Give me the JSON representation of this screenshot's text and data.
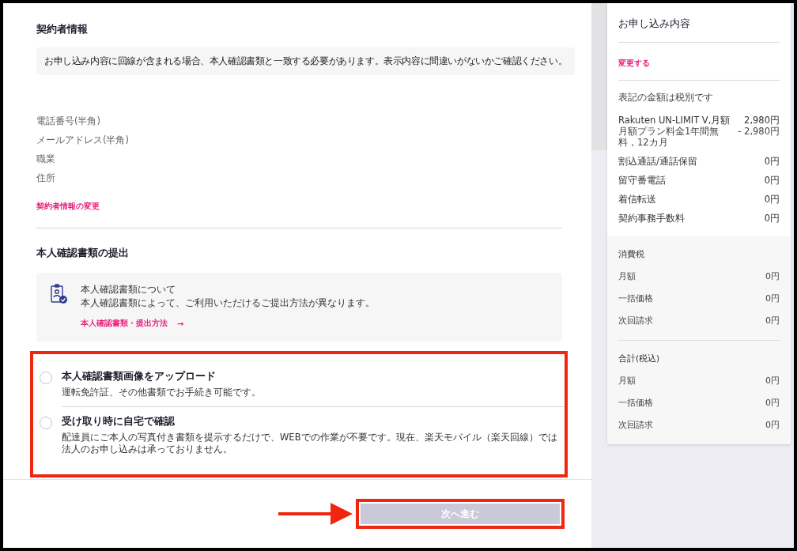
{
  "contract": {
    "title": "契約者情報",
    "notice": "お申し込み内容に回線が含まれる場合、本人確認書類と一致する必要があります。表示内容に間違いがないかご確認ください。",
    "fields": [
      "電話番号(半角)",
      "メールアドレス(半角)",
      "職業",
      "住所"
    ],
    "change_link": "契約者情報の変更"
  },
  "identity": {
    "title": "本人確認書類の提出",
    "info": {
      "title": "本人確認書類について",
      "text": "本人確認書類によって、ご利用いただけるご提出方法が異なります。",
      "link": "本人確認書類・提出方法",
      "link_arrow": "→"
    },
    "options": [
      {
        "title": "本人確認書類画像をアップロード",
        "description": "運転免許証、その他書類でお手続き可能です。",
        "selected": false
      },
      {
        "title": "受け取り時に自宅で確認",
        "description": "配達員にご本人の写真付き書類を提示するだけで、WEBでの作業が不要です。現在、楽天モバイル（楽天回線）では法人のお申し込みは承っておりません。",
        "selected": false
      }
    ]
  },
  "next_button": {
    "label": "次へ進む",
    "disabled": true
  },
  "summary": {
    "title": "お申し込み内容",
    "change_link": "変更する",
    "note": "表記の金額は税別です",
    "items": [
      {
        "label": "Rakuten UN-LIMIT V,月額",
        "price": "2,980円",
        "kind": "main"
      },
      {
        "label": "月額プラン料金1年間無料，12カ月",
        "price": "- 2,980円",
        "kind": "sub"
      },
      {
        "label": "割込通話/通話保留",
        "price": "0円",
        "kind": "main"
      },
      {
        "label": "留守番電話",
        "price": "0円",
        "kind": "main"
      },
      {
        "label": "着信転送",
        "price": "0円",
        "kind": "main"
      },
      {
        "label": "契約事務手数料",
        "price": "0円",
        "kind": "main"
      }
    ],
    "groups": [
      {
        "title": "消費税",
        "rows": [
          {
            "label": "月額",
            "price": "0円"
          },
          {
            "label": "一括価格",
            "price": "0円"
          },
          {
            "label": "次回請求",
            "price": "0円"
          }
        ]
      },
      {
        "title": "合計(税込)",
        "rows": [
          {
            "label": "月額",
            "price": "0円"
          },
          {
            "label": "一括価格",
            "price": "0円"
          },
          {
            "label": "次回請求",
            "price": "0円"
          }
        ]
      }
    ]
  }
}
